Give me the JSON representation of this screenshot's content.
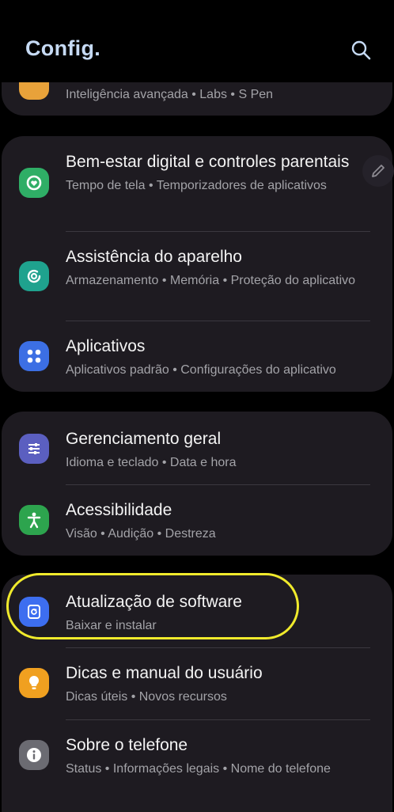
{
  "header": {
    "title": "Config."
  },
  "top_card": {
    "subtitle": "Inteligência avançada • Labs • S Pen"
  },
  "groups": [
    {
      "items": [
        {
          "title": "Bem-estar digital e controles parentais",
          "subtitle": "Tempo de tela • Temporizadores de aplicativos",
          "icon": "digital-wellbeing-icon",
          "color": "#2fae66"
        },
        {
          "title": "Assistência do aparelho",
          "subtitle": "Armazenamento • Memória • Proteção do aplicativo",
          "icon": "device-care-icon",
          "color": "#1fa28e"
        },
        {
          "title": "Aplicativos",
          "subtitle": "Aplicativos padrão • Configurações do aplicativo",
          "icon": "apps-icon",
          "color": "#3c6fe4"
        }
      ]
    },
    {
      "items": [
        {
          "title": "Gerenciamento geral",
          "subtitle": "Idioma e teclado • Data e hora",
          "icon": "sliders-icon",
          "color": "#5b5fc0"
        },
        {
          "title": "Acessibilidade",
          "subtitle": "Visão • Audição • Destreza",
          "icon": "accessibility-icon",
          "color": "#2da44e"
        }
      ]
    },
    {
      "items": [
        {
          "title": "Atualização de software",
          "subtitle": "Baixar e instalar",
          "icon": "software-update-icon",
          "color": "#3d6ef0"
        },
        {
          "title": "Dicas e manual do usuário",
          "subtitle": "Dicas úteis • Novos recursos",
          "icon": "lightbulb-icon",
          "color": "#f0a020"
        },
        {
          "title": "Sobre o telefone",
          "subtitle": "Status • Informações legais • Nome do telefone",
          "icon": "info-icon",
          "color": "#6b6b72"
        }
      ]
    }
  ],
  "highlight_color": "#f0ea2c"
}
